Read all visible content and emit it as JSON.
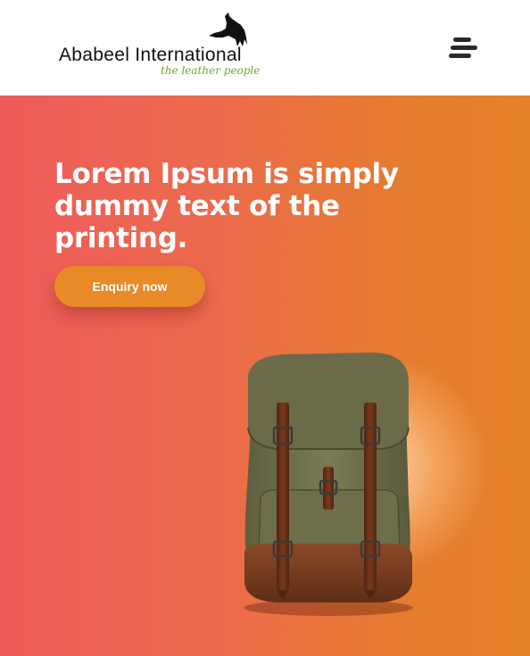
{
  "brand": {
    "name": "Ababeel International",
    "tagline": "the leather people"
  },
  "nav": {
    "menu_icon": "hamburger-menu-icon"
  },
  "hero": {
    "headline": "Lorem Ipsum is simply dummy text of the printing.",
    "cta_label": "Enquiry now",
    "image": "backpack-product-image"
  },
  "colors": {
    "gradient_start": "#ee5b5b",
    "gradient_end": "#e6822a",
    "button": "#e98a28",
    "logo_tagline": "#6aa53a",
    "text_dark": "#111111"
  }
}
